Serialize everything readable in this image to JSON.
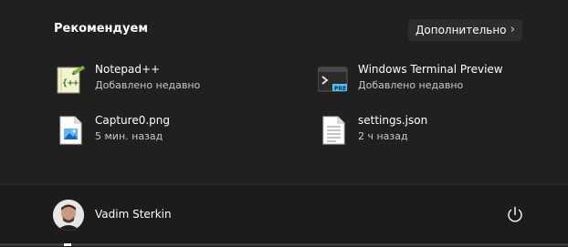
{
  "recommended": {
    "title": "Рекомендуем",
    "more_label": "Дополнительно",
    "items": [
      {
        "name": "Notepad++",
        "subtitle": "Добавлено недавно",
        "icon": "notepadpp-icon"
      },
      {
        "name": "Windows Terminal Preview",
        "subtitle": "Добавлено недавно",
        "icon": "terminal-preview-icon"
      },
      {
        "name": "Capture0.png",
        "subtitle": "5 мин. назад",
        "icon": "image-file-icon"
      },
      {
        "name": "settings.json",
        "subtitle": "2 ч назад",
        "icon": "text-file-icon"
      }
    ]
  },
  "footer": {
    "user_name": "Vadim Sterkin",
    "power_icon": "power-icon"
  },
  "colors": {
    "background": "#202020",
    "footer_background": "#1c1c1c",
    "button_background": "#2d2d2d",
    "secondary_text": "#c9c9c9",
    "terminal_badge": "#4fc3f7"
  }
}
